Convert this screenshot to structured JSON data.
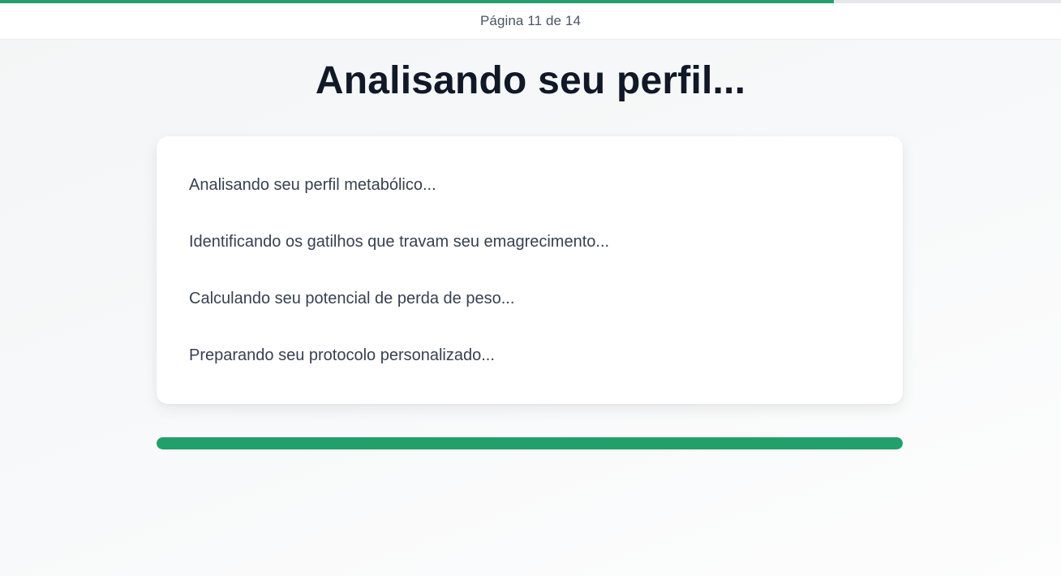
{
  "top_progress": {
    "value_percent": 78.6,
    "color": "#22a06b",
    "track_color": "#e5e7eb"
  },
  "header": {
    "page_indicator": "Página 11 de 14"
  },
  "title": "Analisando seu perfil...",
  "steps": [
    "Analisando seu perfil metabólico...",
    "Identificando os gatilhos que travam seu emagrecimento...",
    "Calculando seu potencial de perda de peso...",
    "Preparando seu protocolo personalizado..."
  ],
  "analysis_progress": {
    "value_percent": 100,
    "color": "#22a06b"
  }
}
